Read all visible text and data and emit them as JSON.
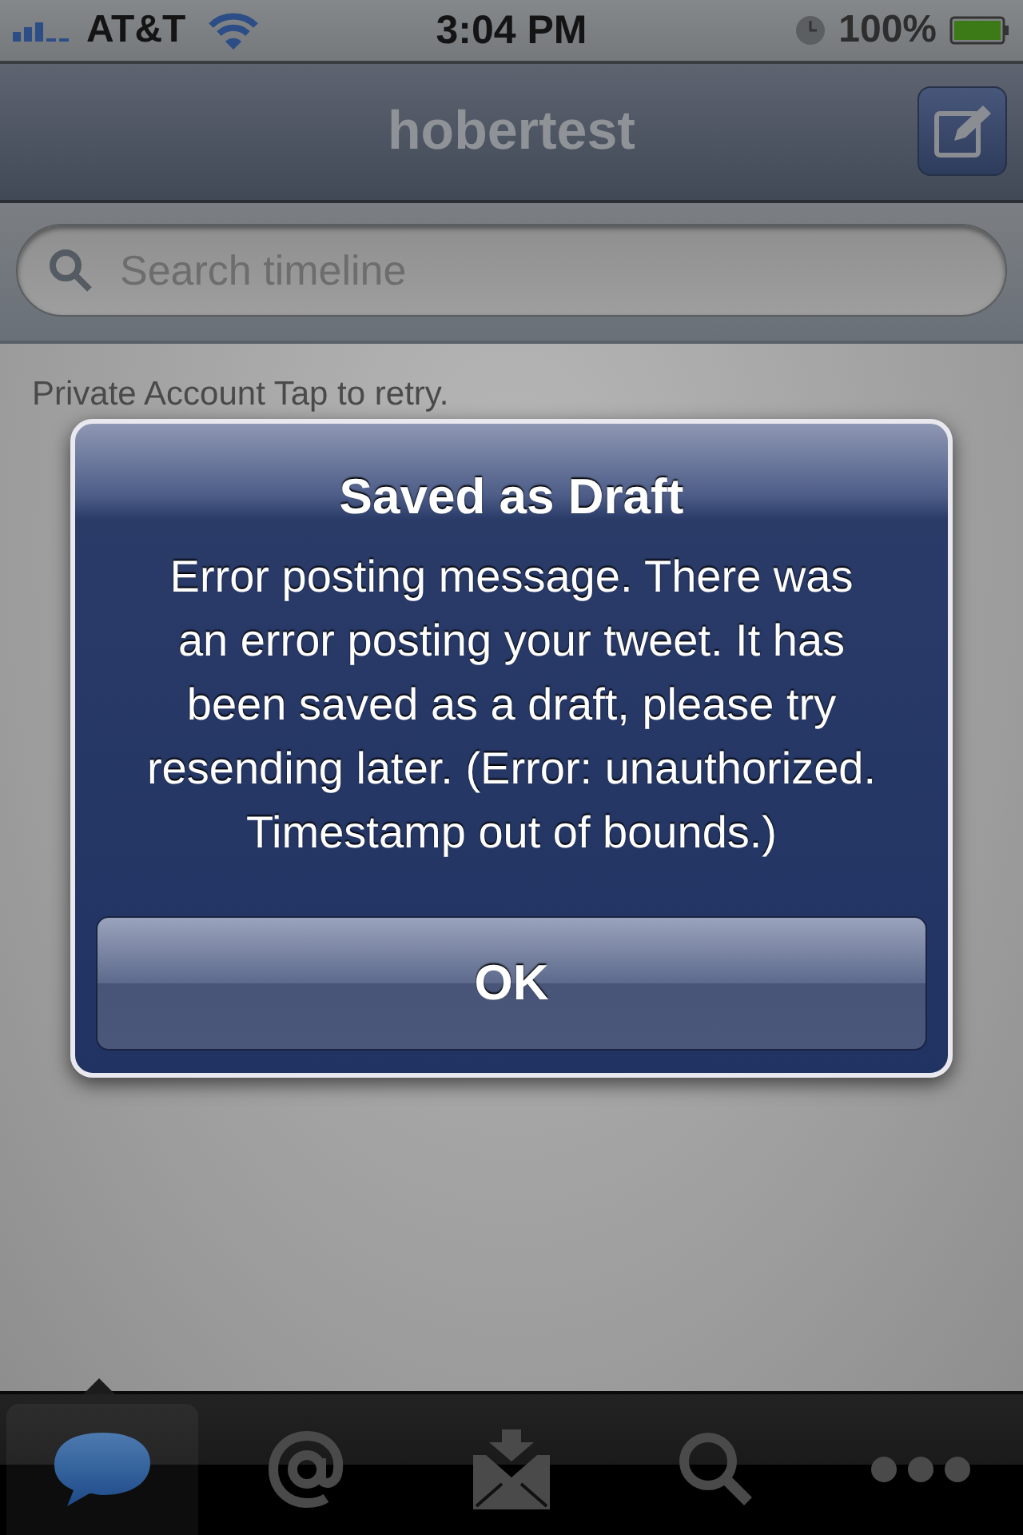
{
  "status_bar": {
    "carrier": "AT&T",
    "time": "3:04 PM",
    "battery": "100%"
  },
  "nav_bar": {
    "title": "hobertest"
  },
  "search": {
    "placeholder": "Search timeline"
  },
  "content": {
    "message": "Private Account Tap to retry."
  },
  "alert": {
    "title": "Saved as Draft",
    "message": "Error posting message. There was an error posting your tweet. It has been saved as a draft, please try resending later. (Error: unauthorized. Timestamp out of bounds.)",
    "buttons": [
      "OK"
    ]
  },
  "tab_bar": {
    "items": [
      {
        "kind": "timeline",
        "selected": true
      },
      {
        "kind": "mentions",
        "selected": false
      },
      {
        "kind": "messages",
        "selected": false
      },
      {
        "kind": "search",
        "selected": false
      },
      {
        "kind": "more",
        "selected": false
      }
    ]
  }
}
